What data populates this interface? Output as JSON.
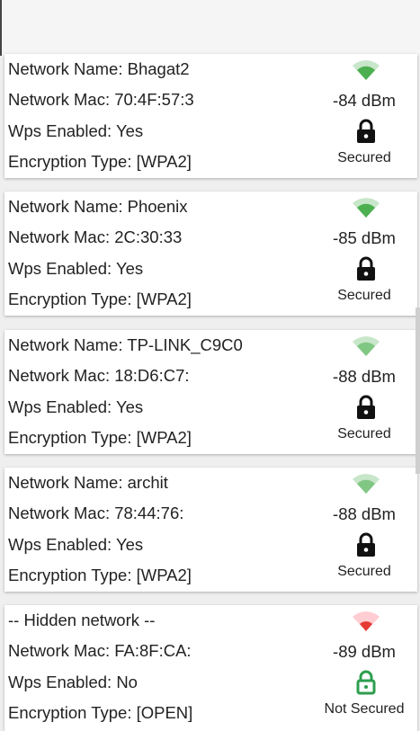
{
  "colors": {
    "good": "#43a047",
    "weak": "#e53935",
    "lock": "#111111",
    "open_lock": "#2e9e4f"
  },
  "networks": [
    {
      "name": "Network Name: Bhagat2",
      "mac": "Network Mac: 70:4F:57:3",
      "wps": "Wps Enabled: Yes",
      "enc": "Encryption Type: [WPA2]",
      "signal": "-84 dBm",
      "status": "Secured",
      "secured": true,
      "signal_strength": "good",
      "wifi_icon": "wifi-good-icon"
    },
    {
      "name": "Network Name: Phoenix",
      "mac": "Network Mac: 2C:30:33",
      "wps": "Wps Enabled: Yes",
      "enc": "Encryption Type: [WPA2]",
      "signal": "-85 dBm",
      "status": "Secured",
      "secured": true,
      "signal_strength": "good",
      "wifi_icon": "wifi-good-icon"
    },
    {
      "name": "Network Name: TP-LINK_C9C0",
      "mac": "Network Mac: 18:D6:C7:",
      "wps": "Wps Enabled: Yes",
      "enc": "Encryption Type: [WPA2]",
      "signal": "-88 dBm",
      "status": "Secured",
      "secured": true,
      "signal_strength": "good",
      "wifi_icon": "wifi-good-icon"
    },
    {
      "name": "Network Name: archit",
      "mac": "Network Mac: 78:44:76:",
      "wps": "Wps Enabled: Yes",
      "enc": "Encryption Type: [WPA2]",
      "signal": "-88 dBm",
      "status": "Secured",
      "secured": true,
      "signal_strength": "good",
      "wifi_icon": "wifi-good-icon"
    },
    {
      "name": "-- Hidden network --",
      "mac": "Network Mac: FA:8F:CA:",
      "wps": "Wps Enabled: No",
      "enc": "Encryption Type: [OPEN]",
      "signal": "-89 dBm",
      "status": "Not Secured",
      "secured": false,
      "signal_strength": "weak",
      "wifi_icon": "wifi-weak-icon"
    }
  ]
}
